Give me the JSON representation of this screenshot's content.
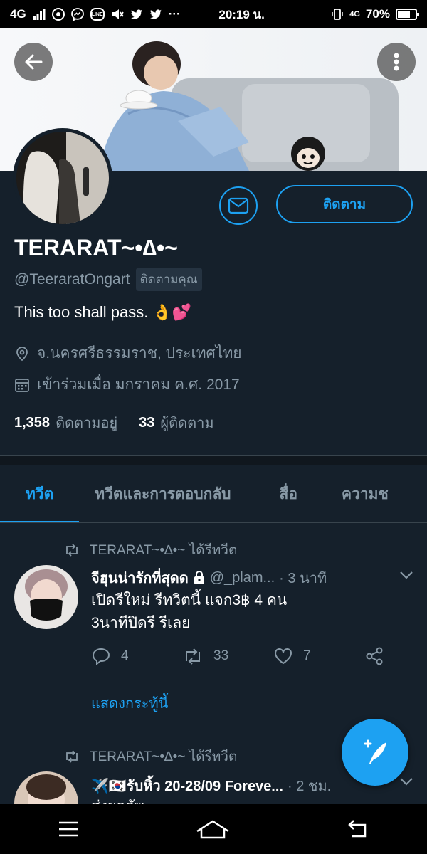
{
  "status_bar": {
    "network": "4G",
    "time": "20:19 น.",
    "network_right": "4G",
    "battery_percent": "70%",
    "battery_level": 0.7,
    "line_badge": "LINE"
  },
  "profile": {
    "name": "TERARAT~•∆•~",
    "handle": "@TeeraratOngart",
    "follows_you": "ติดตามคุณ",
    "bio": "This too shall pass.",
    "bio_emoji": "👌💕",
    "location": "จ.นครศรีธรรมราช, ประเทศไทย",
    "joined": "เข้าร่วมเมื่อ มกราคม ค.ศ. 2017",
    "following_count": "1,358",
    "following_label": "ติดตามอยู่",
    "followers_count": "33",
    "followers_label": "ผู้ติดตาม",
    "follow_button": "ติดตาม"
  },
  "tabs": [
    {
      "label": "ทวีต",
      "active": true
    },
    {
      "label": "ทวีตและการตอบกลับ",
      "active": false
    },
    {
      "label": "สื่อ",
      "active": false
    },
    {
      "label": "ความช",
      "active": false
    }
  ],
  "tweets": [
    {
      "retweet_by": "TERARAT~•∆•~ ได้รีทวีต",
      "author": "จีฮุนน่ารักที่สุดด",
      "username": "@_plam...",
      "time": "· 3 นาที",
      "text_line1": "เปิดรีใหม่ รีทวิตนี้ แจก3฿ 4 คน",
      "text_line2": "3นาทีปิดรี รีเลย",
      "replies": "4",
      "retweets": "33",
      "likes": "7",
      "show_thread": "แสดงกระทู้นี้"
    },
    {
      "retweet_by": "TERARAT~•∆•~ ได้รีทวีต",
      "author": "✈️🇰🇷รับหิ้ว 20-28/09 Foreve...",
      "time": "· 2 ชม.",
      "text_line1": "ส่งผลลัพ..."
    }
  ],
  "colors": {
    "background": "#15202b",
    "accent": "#1da1f2",
    "secondary_text": "#8899a6",
    "divider": "#38444d"
  }
}
